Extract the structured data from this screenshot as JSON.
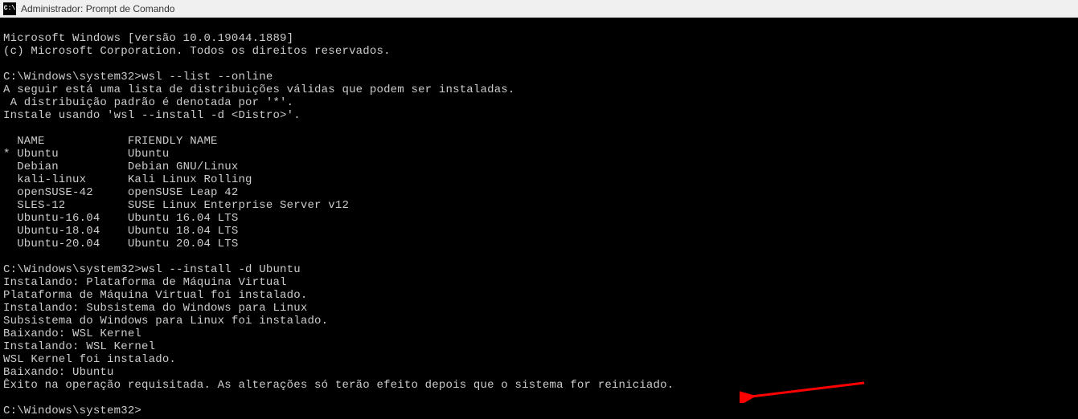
{
  "titlebar": {
    "icon_label": "C:\\",
    "title": "Administrador: Prompt de Comando"
  },
  "terminal": {
    "header": [
      "Microsoft Windows [versão 10.0.19044.1889]",
      "(c) Microsoft Corporation. Todos os direitos reservados.",
      ""
    ],
    "prompt1": "C:\\Windows\\system32>",
    "cmd1": "wsl --list --online",
    "list_intro": [
      "A seguir está uma lista de distribuições válidas que podem ser instaladas.",
      " A distribuição padrão é denotada por '*'.",
      "Instale usando 'wsl --install -d <Distro>'.",
      ""
    ],
    "table_header": {
      "marker": " ",
      "name": "NAME",
      "friendly": "FRIENDLY NAME"
    },
    "distros": [
      {
        "marker": "*",
        "name": "Ubuntu",
        "friendly": "Ubuntu"
      },
      {
        "marker": " ",
        "name": "Debian",
        "friendly": "Debian GNU/Linux"
      },
      {
        "marker": " ",
        "name": "kali-linux",
        "friendly": "Kali Linux Rolling"
      },
      {
        "marker": " ",
        "name": "openSUSE-42",
        "friendly": "openSUSE Leap 42"
      },
      {
        "marker": " ",
        "name": "SLES-12",
        "friendly": "SUSE Linux Enterprise Server v12"
      },
      {
        "marker": " ",
        "name": "Ubuntu-16.04",
        "friendly": "Ubuntu 16.04 LTS"
      },
      {
        "marker": " ",
        "name": "Ubuntu-18.04",
        "friendly": "Ubuntu 18.04 LTS"
      },
      {
        "marker": " ",
        "name": "Ubuntu-20.04",
        "friendly": "Ubuntu 20.04 LTS"
      }
    ],
    "blank_after_table": "",
    "prompt2": "C:\\Windows\\system32>",
    "cmd2": "wsl --install -d Ubuntu",
    "install_output": [
      "Instalando: Plataforma de Máquina Virtual",
      "Plataforma de Máquina Virtual foi instalado.",
      "Instalando: Subsistema do Windows para Linux",
      "Subsistema do Windows para Linux foi instalado.",
      "Baixando: WSL Kernel",
      "Instalando: WSL Kernel",
      "WSL Kernel foi instalado.",
      "Baixando: Ubuntu",
      "Êxito na operação requisitada. As alterações só terão efeito depois que o sistema for reiniciado.",
      ""
    ],
    "prompt3": "C:\\Windows\\system32>"
  },
  "annotation": {
    "arrow_target_line_index": 8
  }
}
